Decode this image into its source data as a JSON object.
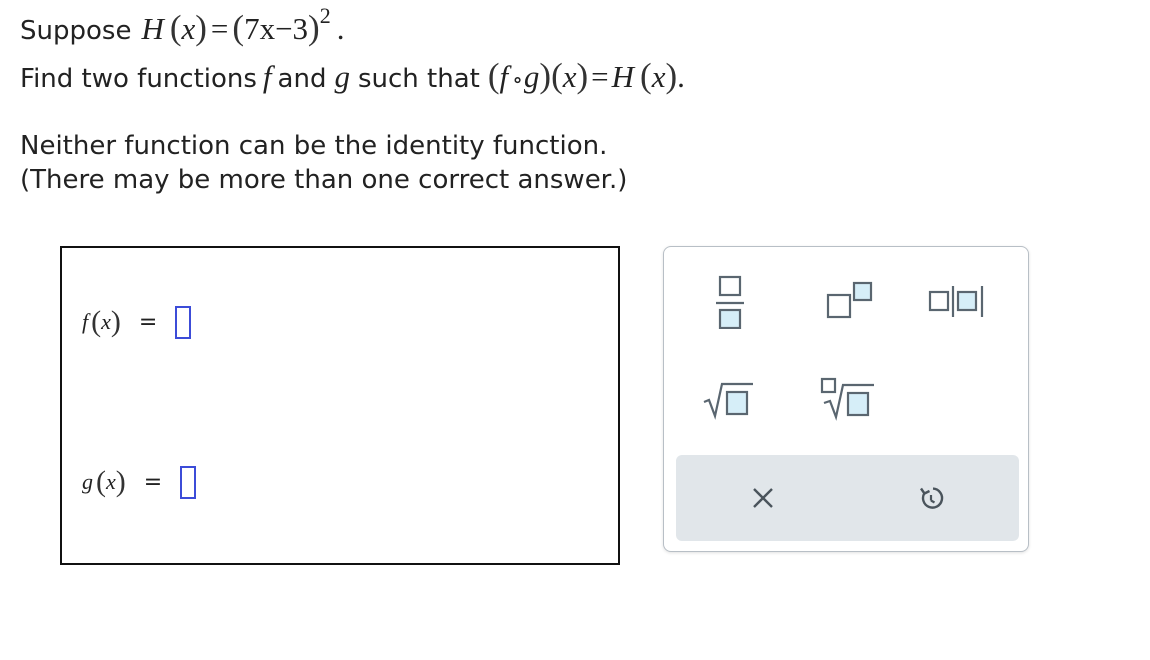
{
  "problem": {
    "line1_prefix": "Suppose",
    "func_H": "H",
    "var_x": "x",
    "equals": "=",
    "inner_expr": "7x−3",
    "exponent": "2",
    "period": ".",
    "line2_prefix": "Find two functions",
    "f": "f",
    "and_word": "and",
    "g": "g",
    "such_that": "such that",
    "compose_op": "∘",
    "instruction1": "Neither function can be the identity function.",
    "instruction2": "(There may be more than one correct answer.)"
  },
  "answer": {
    "f_label": "f",
    "g_label": "g",
    "x_label": "x",
    "equals": "=",
    "f_value": "",
    "g_value": ""
  },
  "palette": {
    "buttons": [
      "fraction",
      "superscript",
      "absolute-value",
      "square-root",
      "nth-root",
      "clear",
      "undo"
    ],
    "clear_glyph": "×",
    "accent_color": "#3c4cd8",
    "icon_color": "#5a6670",
    "icon_fill": "#d6eef8"
  }
}
